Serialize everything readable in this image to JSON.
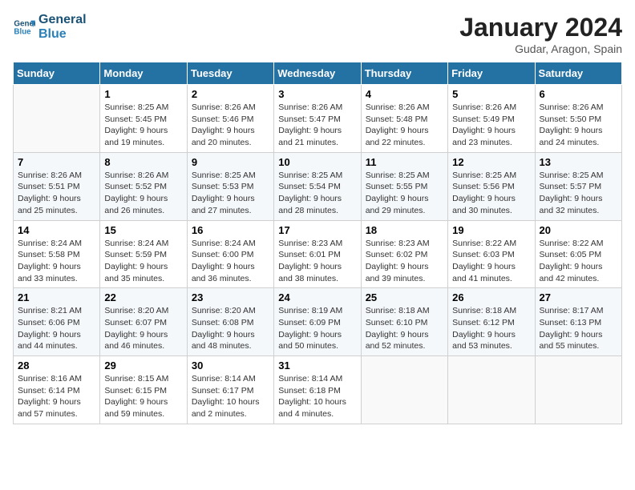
{
  "header": {
    "logo_line1": "General",
    "logo_line2": "Blue",
    "month": "January 2024",
    "location": "Gudar, Aragon, Spain"
  },
  "days_of_week": [
    "Sunday",
    "Monday",
    "Tuesday",
    "Wednesday",
    "Thursday",
    "Friday",
    "Saturday"
  ],
  "weeks": [
    [
      {
        "day": "",
        "info": ""
      },
      {
        "day": "1",
        "info": "Sunrise: 8:25 AM\nSunset: 5:45 PM\nDaylight: 9 hours\nand 19 minutes."
      },
      {
        "day": "2",
        "info": "Sunrise: 8:26 AM\nSunset: 5:46 PM\nDaylight: 9 hours\nand 20 minutes."
      },
      {
        "day": "3",
        "info": "Sunrise: 8:26 AM\nSunset: 5:47 PM\nDaylight: 9 hours\nand 21 minutes."
      },
      {
        "day": "4",
        "info": "Sunrise: 8:26 AM\nSunset: 5:48 PM\nDaylight: 9 hours\nand 22 minutes."
      },
      {
        "day": "5",
        "info": "Sunrise: 8:26 AM\nSunset: 5:49 PM\nDaylight: 9 hours\nand 23 minutes."
      },
      {
        "day": "6",
        "info": "Sunrise: 8:26 AM\nSunset: 5:50 PM\nDaylight: 9 hours\nand 24 minutes."
      }
    ],
    [
      {
        "day": "7",
        "info": "Sunrise: 8:26 AM\nSunset: 5:51 PM\nDaylight: 9 hours\nand 25 minutes."
      },
      {
        "day": "8",
        "info": "Sunrise: 8:26 AM\nSunset: 5:52 PM\nDaylight: 9 hours\nand 26 minutes."
      },
      {
        "day": "9",
        "info": "Sunrise: 8:25 AM\nSunset: 5:53 PM\nDaylight: 9 hours\nand 27 minutes."
      },
      {
        "day": "10",
        "info": "Sunrise: 8:25 AM\nSunset: 5:54 PM\nDaylight: 9 hours\nand 28 minutes."
      },
      {
        "day": "11",
        "info": "Sunrise: 8:25 AM\nSunset: 5:55 PM\nDaylight: 9 hours\nand 29 minutes."
      },
      {
        "day": "12",
        "info": "Sunrise: 8:25 AM\nSunset: 5:56 PM\nDaylight: 9 hours\nand 30 minutes."
      },
      {
        "day": "13",
        "info": "Sunrise: 8:25 AM\nSunset: 5:57 PM\nDaylight: 9 hours\nand 32 minutes."
      }
    ],
    [
      {
        "day": "14",
        "info": "Sunrise: 8:24 AM\nSunset: 5:58 PM\nDaylight: 9 hours\nand 33 minutes."
      },
      {
        "day": "15",
        "info": "Sunrise: 8:24 AM\nSunset: 5:59 PM\nDaylight: 9 hours\nand 35 minutes."
      },
      {
        "day": "16",
        "info": "Sunrise: 8:24 AM\nSunset: 6:00 PM\nDaylight: 9 hours\nand 36 minutes."
      },
      {
        "day": "17",
        "info": "Sunrise: 8:23 AM\nSunset: 6:01 PM\nDaylight: 9 hours\nand 38 minutes."
      },
      {
        "day": "18",
        "info": "Sunrise: 8:23 AM\nSunset: 6:02 PM\nDaylight: 9 hours\nand 39 minutes."
      },
      {
        "day": "19",
        "info": "Sunrise: 8:22 AM\nSunset: 6:03 PM\nDaylight: 9 hours\nand 41 minutes."
      },
      {
        "day": "20",
        "info": "Sunrise: 8:22 AM\nSunset: 6:05 PM\nDaylight: 9 hours\nand 42 minutes."
      }
    ],
    [
      {
        "day": "21",
        "info": "Sunrise: 8:21 AM\nSunset: 6:06 PM\nDaylight: 9 hours\nand 44 minutes."
      },
      {
        "day": "22",
        "info": "Sunrise: 8:20 AM\nSunset: 6:07 PM\nDaylight: 9 hours\nand 46 minutes."
      },
      {
        "day": "23",
        "info": "Sunrise: 8:20 AM\nSunset: 6:08 PM\nDaylight: 9 hours\nand 48 minutes."
      },
      {
        "day": "24",
        "info": "Sunrise: 8:19 AM\nSunset: 6:09 PM\nDaylight: 9 hours\nand 50 minutes."
      },
      {
        "day": "25",
        "info": "Sunrise: 8:18 AM\nSunset: 6:10 PM\nDaylight: 9 hours\nand 52 minutes."
      },
      {
        "day": "26",
        "info": "Sunrise: 8:18 AM\nSunset: 6:12 PM\nDaylight: 9 hours\nand 53 minutes."
      },
      {
        "day": "27",
        "info": "Sunrise: 8:17 AM\nSunset: 6:13 PM\nDaylight: 9 hours\nand 55 minutes."
      }
    ],
    [
      {
        "day": "28",
        "info": "Sunrise: 8:16 AM\nSunset: 6:14 PM\nDaylight: 9 hours\nand 57 minutes."
      },
      {
        "day": "29",
        "info": "Sunrise: 8:15 AM\nSunset: 6:15 PM\nDaylight: 9 hours\nand 59 minutes."
      },
      {
        "day": "30",
        "info": "Sunrise: 8:14 AM\nSunset: 6:17 PM\nDaylight: 10 hours\nand 2 minutes."
      },
      {
        "day": "31",
        "info": "Sunrise: 8:14 AM\nSunset: 6:18 PM\nDaylight: 10 hours\nand 4 minutes."
      },
      {
        "day": "",
        "info": ""
      },
      {
        "day": "",
        "info": ""
      },
      {
        "day": "",
        "info": ""
      }
    ]
  ]
}
